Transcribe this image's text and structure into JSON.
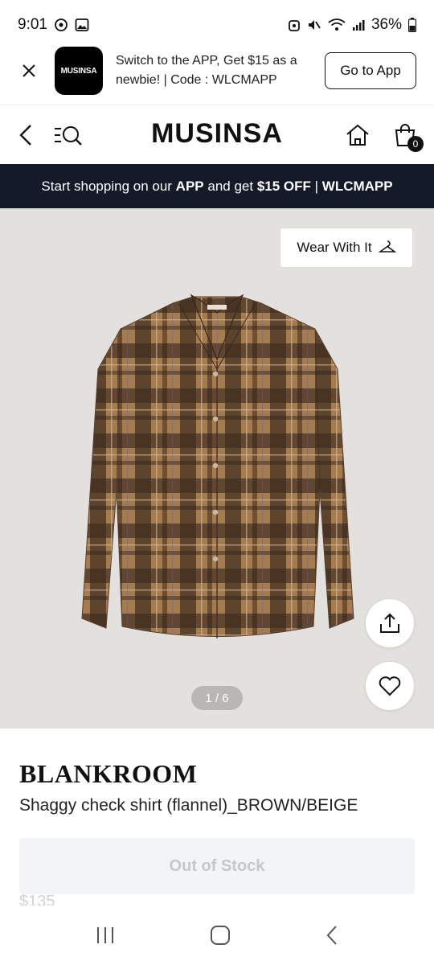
{
  "status_bar": {
    "time": "9:01",
    "battery": "36%"
  },
  "app_banner": {
    "logo_text": "MUSINSA",
    "message": "Switch to the APP, Get $15 as a newbie! | Code : WLCMAPP",
    "button_label": "Go to App"
  },
  "header": {
    "brand": "MUSINSA",
    "cart_count": "0"
  },
  "promo": {
    "text_1": "Start shopping on our ",
    "bold_1": "APP",
    "text_2": " and get ",
    "bold_2": "$15 OFF",
    "text_3": " | ",
    "bold_3": "WLCMAPP"
  },
  "gallery": {
    "wear_label": "Wear With It",
    "pager": "1 / 6"
  },
  "product": {
    "brand": "BLANKROOM",
    "name": "Shaggy check shirt (flannel)_BROWN/BEIGE",
    "stock_label": "Out of Stock",
    "price": "$135"
  },
  "colors": {
    "promo_bg": "#151a2a",
    "hero_bg": "#e3e1dd",
    "shirt_base": "#9b7447"
  }
}
